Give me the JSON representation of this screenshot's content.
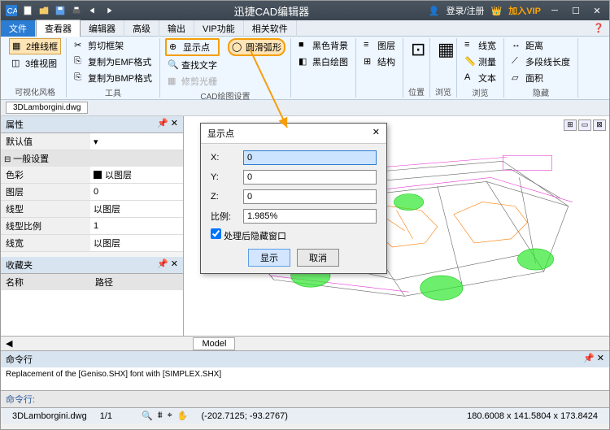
{
  "titlebar": {
    "title": "迅捷CAD编辑器",
    "login": "登录/注册",
    "vip": "加入VIP"
  },
  "menu": {
    "tabs": [
      "文件",
      "查看器",
      "编辑器",
      "高级",
      "输出",
      "VIP功能",
      "相关软件"
    ]
  },
  "ribbon": {
    "g1": {
      "items": [
        "2维线框",
        "3维视图"
      ],
      "label": "可视化风格"
    },
    "g2": {
      "items": [
        "剪切框架",
        "复制为EMF格式",
        "复制为BMP格式"
      ],
      "label": "工具"
    },
    "g3": {
      "items": [
        "显示点",
        "查找文字",
        "修剪光栅",
        "圆滑弧形"
      ],
      "label": "CAD绘图设置"
    },
    "g4": {
      "items": [
        "黑色背景",
        "黑白绘图"
      ]
    },
    "g5": {
      "items": [
        "图层",
        "结构"
      ]
    },
    "g6": {
      "label": "位置"
    },
    "g7": {
      "label": "浏览"
    },
    "g8": {
      "items": [
        "线宽",
        "测量",
        "文本"
      ],
      "label": "浏览"
    },
    "g9": {
      "items": [
        "距离",
        "多段线长度",
        "面积"
      ],
      "label": "隐藏"
    }
  },
  "filetab": "3DLamborgini.dwg",
  "props": {
    "title": "属性",
    "default": "默认值",
    "section": "一般设置",
    "rows": [
      [
        "色彩",
        "以图层"
      ],
      [
        "图层",
        "0"
      ],
      [
        "线型",
        "以图层"
      ],
      [
        "线型比例",
        "1"
      ],
      [
        "线宽",
        "以图层"
      ]
    ]
  },
  "fav": {
    "title": "收藏夹",
    "cols": [
      "名称",
      "路径"
    ]
  },
  "canvas": {
    "ctrls": [
      "⊞",
      "▭",
      "⊠"
    ]
  },
  "modeltab": "Model",
  "cmd": {
    "title": "命令行",
    "text": "Replacement of the [Geniso.SHX] font with [SIMPLEX.SHX]",
    "prompt": "命令行:"
  },
  "status": {
    "file": "3DLamborgini.dwg",
    "page": "1/1",
    "coords": "(-202.7125; -93.2767)",
    "dims": "180.6008 x 141.5804 x 173.8424"
  },
  "dialog": {
    "title": "显示点",
    "x_label": "X:",
    "y_label": "Y:",
    "z_label": "Z:",
    "ratio_label": "比例:",
    "x": "0",
    "y": "0",
    "z": "0",
    "ratio": "1.985%",
    "chk": "处理后隐藏窗口",
    "ok": "显示",
    "cancel": "取消"
  }
}
